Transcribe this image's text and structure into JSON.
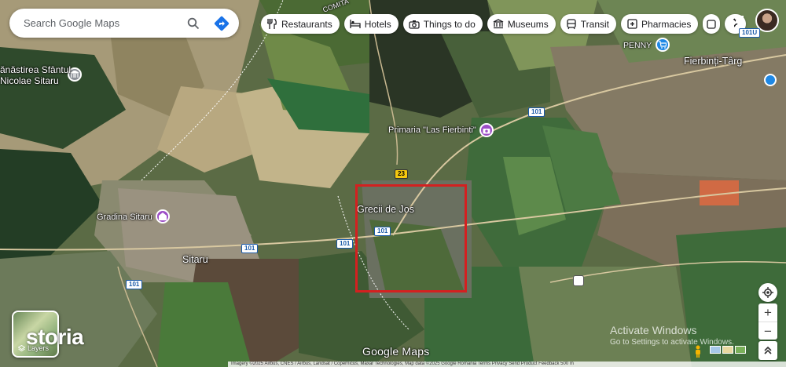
{
  "search": {
    "placeholder": "Search Google Maps"
  },
  "chips": [
    {
      "label": "Restaurants",
      "icon": "restaurant-icon"
    },
    {
      "label": "Hotels",
      "icon": "hotel-icon"
    },
    {
      "label": "Things to do",
      "icon": "camera-icon"
    },
    {
      "label": "Museums",
      "icon": "museum-icon"
    },
    {
      "label": "Transit",
      "icon": "transit-icon"
    },
    {
      "label": "Pharmacies",
      "icon": "pharmacy-icon"
    }
  ],
  "places": {
    "manastirea": "ănăstirea Sfântul\nNicolae Sitaru",
    "manastirea_l1": "ănăstirea Sfântul",
    "manastirea_l2": "Nicolae Sitaru",
    "penny": "PENNY",
    "fierbinti": "Fierbinți-Târg",
    "primaria": "Primaria \"Las Fierbinti\"",
    "grecii": "Grecii de Jos",
    "gradina": "Gradina Sitaru",
    "sitaru": "Sitaru",
    "comita": "COMITA"
  },
  "roads": {
    "r101a": "101",
    "r101b": "101",
    "r101c": "101",
    "r101d": "101",
    "r101e": "101",
    "r101u": "101U",
    "r23": "23"
  },
  "layers": {
    "label": "Layers"
  },
  "watermark": "storia",
  "google_logo": "Google Maps",
  "activate": {
    "title": "Activate Windows",
    "subtitle": "Go to Settings to activate Windows."
  },
  "footer": "Imagery ©2025 Airbus, CNES / Airbus, Landsat / Copernicus, Maxar Technologies, Map data ©2025 Google    Romania    Terms    Privacy    Send Product Feedback    500 m",
  "colors": {
    "highlight": "#d42020",
    "poi_purple": "#9c4ec6",
    "poi_blue": "#1e88e5"
  }
}
